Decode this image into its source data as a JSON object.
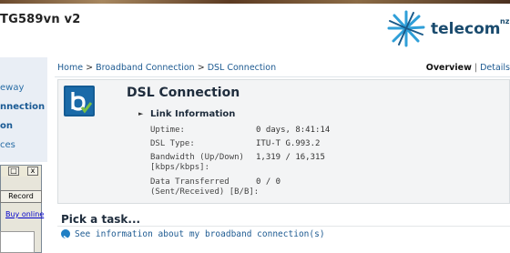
{
  "header": {
    "device_title": "TG589vn v2",
    "brand": "telecom",
    "brand_suffix": "nz"
  },
  "sidebar": {
    "items": [
      {
        "label": "eway",
        "active": false
      },
      {
        "label": "nnection",
        "active": true
      },
      {
        "label": "on",
        "active": true
      },
      {
        "label": "ces",
        "active": false
      }
    ]
  },
  "breadcrumb": {
    "home": "Home",
    "broadband": "Broadband Connection",
    "current": "DSL Connection",
    "sep": ">"
  },
  "view_tabs": {
    "overview": "Overview",
    "details": "Details"
  },
  "panel": {
    "title": "DSL Connection",
    "section": "Link Information",
    "rows": [
      {
        "label": "Uptime:",
        "value": "0 days, 8:41:14"
      },
      {
        "label": "DSL Type:",
        "value": "ITU-T G.993.2"
      },
      {
        "label": "Bandwidth (Up/Down)",
        "label2": "[kbps/kbps]:",
        "value": "1,319 / 16,315"
      },
      {
        "label": "Data Transferred",
        "label2": "(Sent/Received) [B/B]:",
        "value": "0 / 0"
      }
    ]
  },
  "tasks": {
    "title": "Pick a task...",
    "link": "See information about my broadband connection(s)"
  },
  "popup": {
    "record_label": "Record",
    "buy_label": "Buy online",
    "min_glyph": "□",
    "close_glyph": "x"
  },
  "colors": {
    "link": "#1d5a91",
    "brand": "#1a4b6e",
    "panel_bg": "#f3f4f5",
    "icon_blue": "#1a6aa8"
  }
}
